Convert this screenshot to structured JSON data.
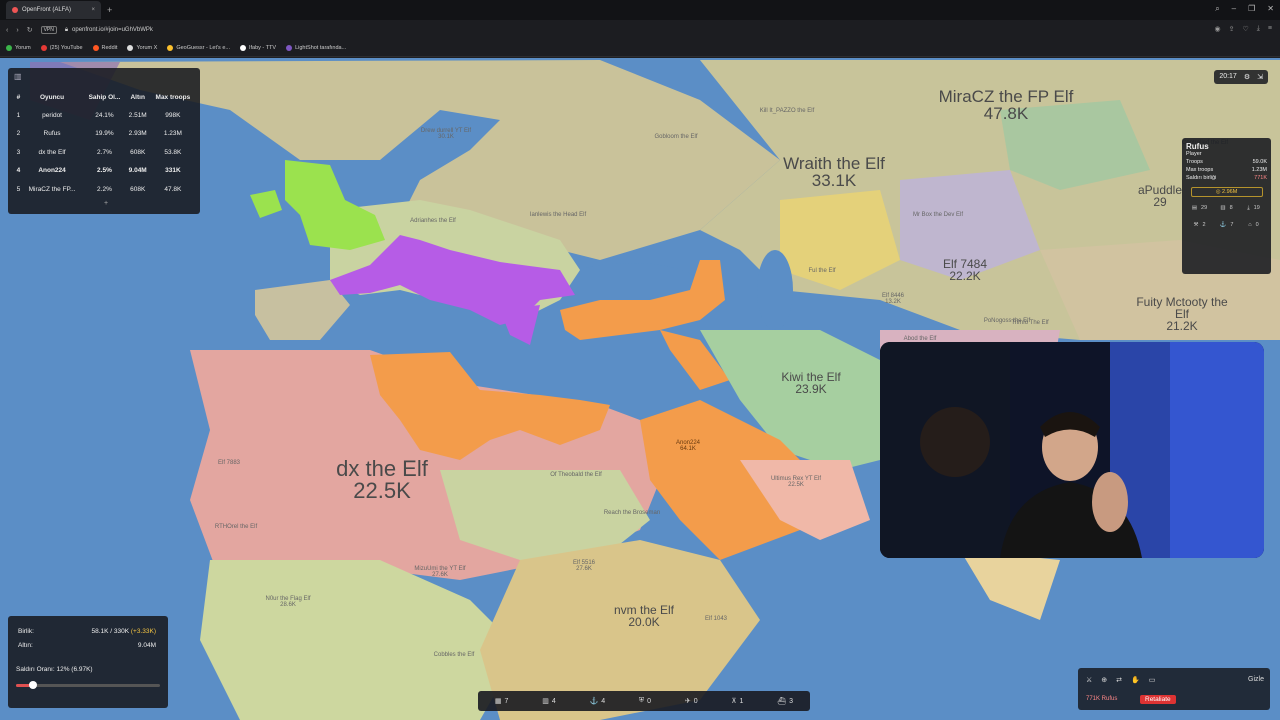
{
  "browser": {
    "tab_title": "OpenFront (ALFA)",
    "new_tab": "+",
    "url": "openfront.io/#join=uGhVbWPk",
    "vpn": "VPN",
    "bookmarks": [
      {
        "label": "Yorum",
        "color": "#3bb54a"
      },
      {
        "label": "(25) YouTube",
        "color": "#e53935"
      },
      {
        "label": "Reddit",
        "color": "#ff5722"
      },
      {
        "label": "Yorum X",
        "color": "#dddddd"
      },
      {
        "label": "GeoGuessr - Let's e...",
        "color": "#fbc02d"
      },
      {
        "label": "Ifaby - TTV",
        "color": "#ffffff"
      },
      {
        "label": "LightShot tarafında...",
        "color": "#7e57c2"
      }
    ]
  },
  "leaderboard": {
    "headers": [
      "#",
      "Oyuncu",
      "Sahip Ol...",
      "Altın",
      "Max troops"
    ],
    "rows": [
      {
        "rank": "1",
        "name": "peridot",
        "owned": "24.1%",
        "gold": "2.51M",
        "troops": "998K",
        "me": false
      },
      {
        "rank": "2",
        "name": "Rufus",
        "owned": "19.9%",
        "gold": "2.93M",
        "troops": "1.23M",
        "me": false
      },
      {
        "rank": "3",
        "name": "dx the Elf",
        "owned": "2.7%",
        "gold": "608K",
        "troops": "53.8K",
        "me": false
      },
      {
        "rank": "4",
        "name": "Anon224",
        "owned": "2.5%",
        "gold": "9.04M",
        "troops": "331K",
        "me": true
      },
      {
        "rank": "5",
        "name": "MiraCZ the FP...",
        "owned": "2.2%",
        "gold": "608K",
        "troops": "47.8K",
        "me": false
      }
    ],
    "more": "+"
  },
  "timer": "20:17",
  "player_panel": {
    "name": "Rufus",
    "type": "Player",
    "rows": [
      {
        "k": "Troops",
        "v": "59.0K"
      },
      {
        "k": "Max troops",
        "v": "1.23M"
      },
      {
        "k": "Saldırı birliği",
        "v": "771K"
      }
    ],
    "gold": "2.96M",
    "grid": [
      "29",
      "8",
      "19",
      "2",
      "7",
      "0"
    ]
  },
  "map_labels": [
    {
      "t": "MiraCZ the FP Elf",
      "s": "47.8K"
    },
    {
      "t": "Wraith the Elf",
      "s": "33.1K"
    },
    {
      "t": "Fuity Mctooty the Elf",
      "s": "21.2K"
    },
    {
      "t": "Kiwi the Elf",
      "s": "23.9K"
    },
    {
      "t": "dx the Elf",
      "s": "22.5K"
    },
    {
      "t": "Anon224",
      "s": "64.1K"
    },
    {
      "t": "Elf 7484",
      "s": "22.2K"
    },
    {
      "t": "aPuddle",
      "s": "29"
    },
    {
      "t": "Ultimus Rex YT Elf",
      "s": "22.5K"
    },
    {
      "t": "Elf 5516",
      "s": "27.6K"
    },
    {
      "t": "nvm the Elf",
      "s": "20.0K"
    },
    {
      "t": "MizuUmi the YT Elf",
      "s": "27.6K"
    },
    {
      "t": "N0ur the Flag Elf",
      "s": "28.6K"
    },
    {
      "t": "Drew durrell YT Elf",
      "s": "30.1K"
    },
    {
      "t": "Elf 8446",
      "s": "13.2K"
    }
  ],
  "small_labels": [
    "Kill It_PAZZO the Elf",
    "Gobloom the Elf",
    "Adrianhes the Elf",
    "Ianlewis the Head Elf",
    "Ful the Elf",
    "Mr Box the Dev Elf",
    "PoNogoss the Elf",
    "Abod the Elf",
    "Elf 7883",
    "RTHOrel the Elf",
    "Of Theobald the Elf",
    "Reach the Broseman",
    "Cobbles the Elf",
    "Controlled the Elf",
    "Elf 1043",
    "Trimfo The Elf"
  ],
  "stats": {
    "troops_label": "Birlik:",
    "troops_value": "58.1K / 330K",
    "troops_delta": "(+3.33K)",
    "gold_label": "Altın:",
    "gold_value": "9.04M",
    "attack_ratio": "Saldırı Oranı: 12% (6.97K)",
    "attack_fraction": 0.12
  },
  "bottombar": [
    "7",
    "4",
    "4",
    "0",
    "0",
    "1",
    "3"
  ],
  "bottom_right": {
    "hide": "Gizle",
    "message": "771K Rufus",
    "retaliate": "Retaliate"
  },
  "colors": {
    "ocean": "#5b8ec6",
    "player": "#f39c4b",
    "peridot": "#b65ce6",
    "rufus_green": "#9be24e"
  }
}
